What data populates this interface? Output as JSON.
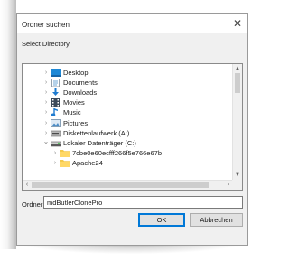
{
  "window": {
    "title": "Ordner suchen",
    "close_glyph": "✕",
    "subtitle": "Select Directory"
  },
  "tree": {
    "items": [
      {
        "label": "Desktop",
        "icon": "desktop-icon",
        "expanded": false,
        "level": 0
      },
      {
        "label": "Documents",
        "icon": "documents-icon",
        "expanded": false,
        "level": 0
      },
      {
        "label": "Downloads",
        "icon": "downloads-icon",
        "expanded": false,
        "level": 0
      },
      {
        "label": "Movies",
        "icon": "movies-icon",
        "expanded": false,
        "level": 0
      },
      {
        "label": "Music",
        "icon": "music-icon",
        "expanded": false,
        "level": 0
      },
      {
        "label": "Pictures",
        "icon": "pictures-icon",
        "expanded": false,
        "level": 0
      },
      {
        "label": "Diskettenlaufwerk (A:)",
        "icon": "floppy-drive-icon",
        "expanded": false,
        "level": 0
      },
      {
        "label": "Lokaler Datenträger (C:)",
        "icon": "hard-drive-icon",
        "expanded": true,
        "level": 0
      },
      {
        "label": "7cbe0e60ecfff266f5e766e67b",
        "icon": "folder-icon",
        "expanded": false,
        "level": 1
      },
      {
        "label": "Apache24",
        "icon": "folder-icon",
        "expanded": false,
        "level": 1
      }
    ]
  },
  "scrollbar": {
    "up": "▲",
    "down": "▼",
    "left": "‹",
    "right": "›"
  },
  "folder_field": {
    "label": "Ordner:",
    "value": "mdButlerClonePro"
  },
  "buttons": {
    "ok": "OK",
    "cancel": "Abbrechen"
  },
  "colors": {
    "dialog_bg": "#f0f0f0",
    "accent": "#0078d7",
    "folder_yellow": "#f3c94c"
  }
}
